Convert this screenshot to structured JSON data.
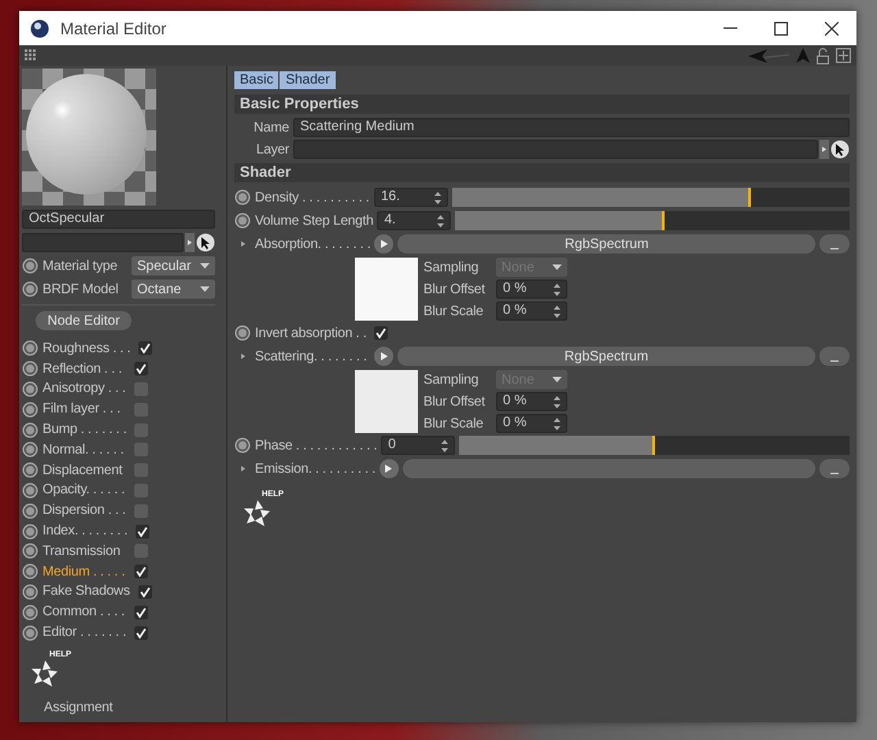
{
  "window": {
    "title": "Material Editor"
  },
  "preview": {
    "material_name": "OctSpecular"
  },
  "material_settings": [
    {
      "label": "Material type",
      "value": "Specular"
    },
    {
      "label": "BRDF Model",
      "value": "Octane"
    }
  ],
  "node_editor_button": "Node Editor",
  "channels": [
    {
      "name": "Roughness . . .",
      "checked": true,
      "selected": false
    },
    {
      "name": "Reflection . . .",
      "checked": true,
      "selected": false
    },
    {
      "name": "Anisotropy . . .",
      "checked": false,
      "selected": false
    },
    {
      "name": "Film layer . . .",
      "checked": false,
      "selected": false
    },
    {
      "name": "Bump . . . . . . .",
      "checked": false,
      "selected": false
    },
    {
      "name": "Normal. . . . . .",
      "checked": false,
      "selected": false
    },
    {
      "name": "Displacement",
      "checked": false,
      "selected": false
    },
    {
      "name": "Opacity. . . . . .",
      "checked": false,
      "selected": false
    },
    {
      "name": "Dispersion . . .",
      "checked": false,
      "selected": false
    },
    {
      "name": "Index. . . . . . . .",
      "checked": true,
      "selected": false
    },
    {
      "name": "Transmission",
      "checked": false,
      "selected": false
    },
    {
      "name": "Medium . . . . .",
      "checked": true,
      "selected": true
    },
    {
      "name": "Fake Shadows",
      "checked": true,
      "selected": false
    },
    {
      "name": "Common . . . .",
      "checked": true,
      "selected": false
    },
    {
      "name": "Editor . . . . . . .",
      "checked": true,
      "selected": false
    }
  ],
  "help_badge": "HELP",
  "assignment_label": "Assignment",
  "tabs": [
    {
      "label": "Basic",
      "selected": true
    },
    {
      "label": "Shader",
      "selected": true
    }
  ],
  "basic_properties": {
    "title": "Basic Properties",
    "name_label": "Name",
    "name_value": "Scattering Medium",
    "layer_label": "Layer"
  },
  "shader": {
    "title": "Shader",
    "rows": [
      {
        "kind": "slider",
        "label": "Density . . . . . . . . . .",
        "value": "16.",
        "level": 0.75
      },
      {
        "kind": "slider",
        "label": "Volume Step Length",
        "value": "4.",
        "level": 0.53
      },
      {
        "kind": "texture",
        "label": "Absorption. . . . . . . .",
        "shader": "RgbSpectrum",
        "options": [
          {
            "label": "Sampling",
            "value": "None",
            "disabled": true
          },
          {
            "label": "Blur Offset",
            "value": "0 %",
            "disabled": false
          },
          {
            "label": "Blur Scale",
            "value": "0 %",
            "disabled": false
          }
        ]
      },
      {
        "kind": "checkbox",
        "label": "Invert absorption . .",
        "checked": true
      },
      {
        "kind": "texture",
        "label": "Scattering. . . . . . . .",
        "shader": "RgbSpectrum",
        "options": [
          {
            "label": "Sampling",
            "value": "None",
            "disabled": true
          },
          {
            "label": "Blur Offset",
            "value": "0 %",
            "disabled": false
          },
          {
            "label": "Blur Scale",
            "value": "0 %",
            "disabled": false
          }
        ]
      },
      {
        "kind": "slider",
        "label": "Phase . . . . . . . . . . . .",
        "value": "0",
        "level": 0.5
      },
      {
        "kind": "texture",
        "label": "Emission. . . . . . . . . ."
      }
    ]
  },
  "shader_help_badge": "HELP"
}
